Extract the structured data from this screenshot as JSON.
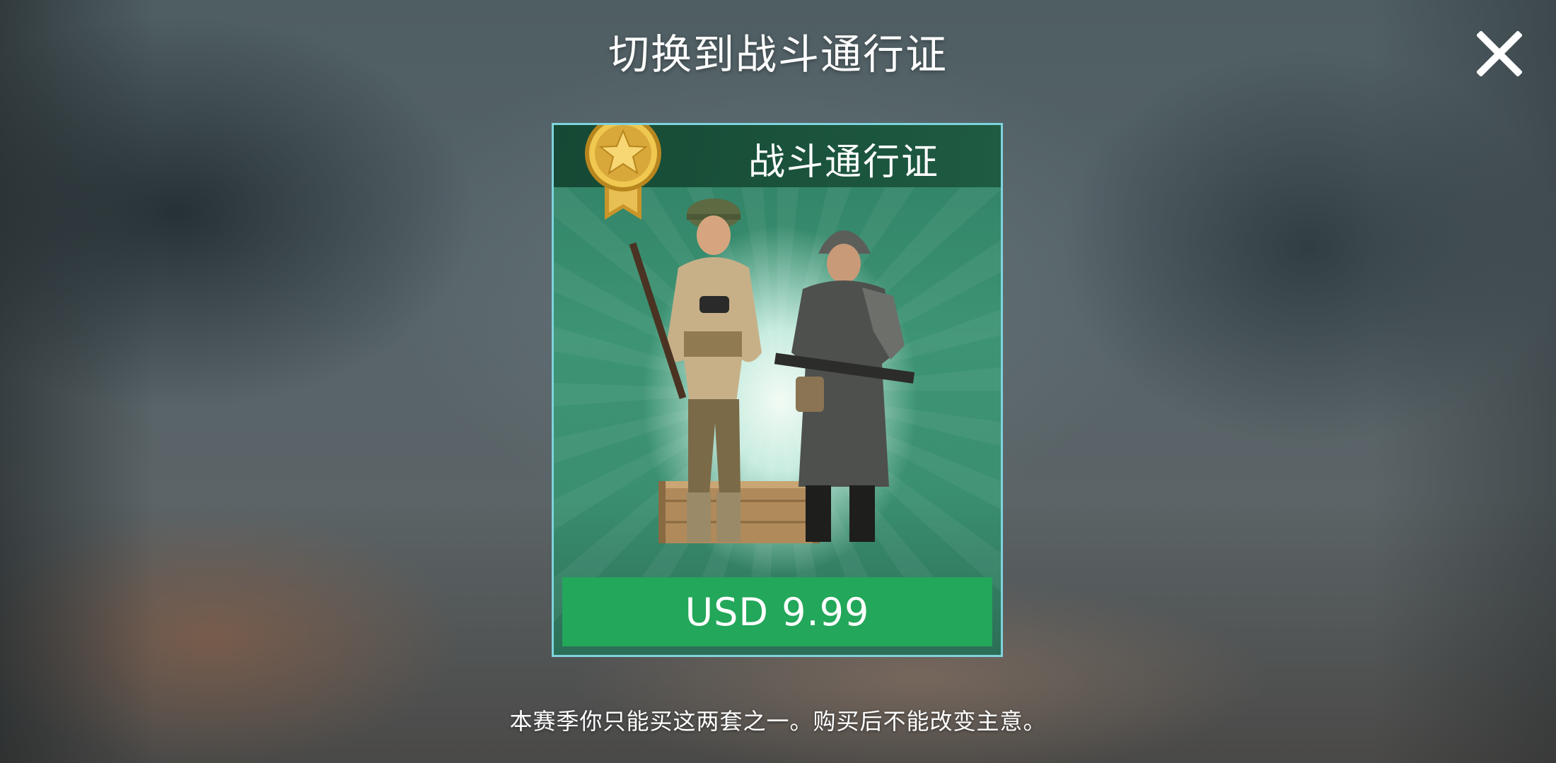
{
  "dialog": {
    "title": "切换到战斗通行证",
    "close_icon": "close-icon"
  },
  "card": {
    "title": "战斗通行证",
    "badge_icon": "star-medal-icon",
    "illustration": "two-soldiers",
    "price_label": "USD 9.99"
  },
  "footer": {
    "note": "本赛季你只能买这两套之一。购买后不能改变主意。"
  },
  "colors": {
    "card_border": "#7fd3dc",
    "card_bg": "#3a8f70",
    "header_bg": "#1e5840",
    "price_button": "#23a75a",
    "medal_gold": "#e0b23a"
  }
}
